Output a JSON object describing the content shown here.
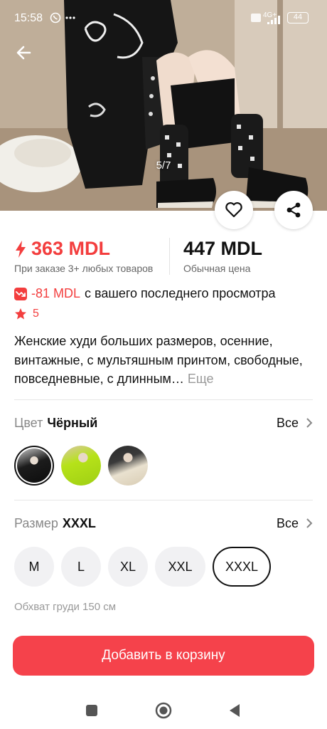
{
  "status_bar": {
    "time": "15:58",
    "battery": "44",
    "network": "4G+"
  },
  "hero": {
    "page_indicator": "5/7"
  },
  "prices": {
    "promo_price": "363 MDL",
    "promo_note": "При заказе 3+ любых товаров",
    "regular_price": "447 MDL",
    "regular_note": "Обычная цена"
  },
  "price_drop": {
    "amount": "-81 MDL",
    "text": "с вашего последнего просмотра"
  },
  "rating": {
    "value": "5"
  },
  "description": {
    "text": "Женские худи больших размеров, осенние, винтажные, с мультяшным принтом, свободные, повседневные, с длинным…",
    "more_label": "Еще"
  },
  "color_option": {
    "label": "Цвет",
    "value": "Чёрный",
    "all_label": "Все",
    "swatches": [
      {
        "name": "black",
        "selected": true
      },
      {
        "name": "yellow-green",
        "selected": false
      },
      {
        "name": "beige",
        "selected": false
      }
    ]
  },
  "size_option": {
    "label": "Размер",
    "value": "XXXL",
    "all_label": "Все",
    "sizes": [
      "M",
      "L",
      "XL",
      "XXL",
      "XXXL"
    ],
    "selected": "XXXL",
    "measurement": "Обхват груди 150 см"
  },
  "cart_button": {
    "label": "Добавить в корзину"
  },
  "colors": {
    "accent": "#f33e3e",
    "cart_button": "#f5424b"
  }
}
